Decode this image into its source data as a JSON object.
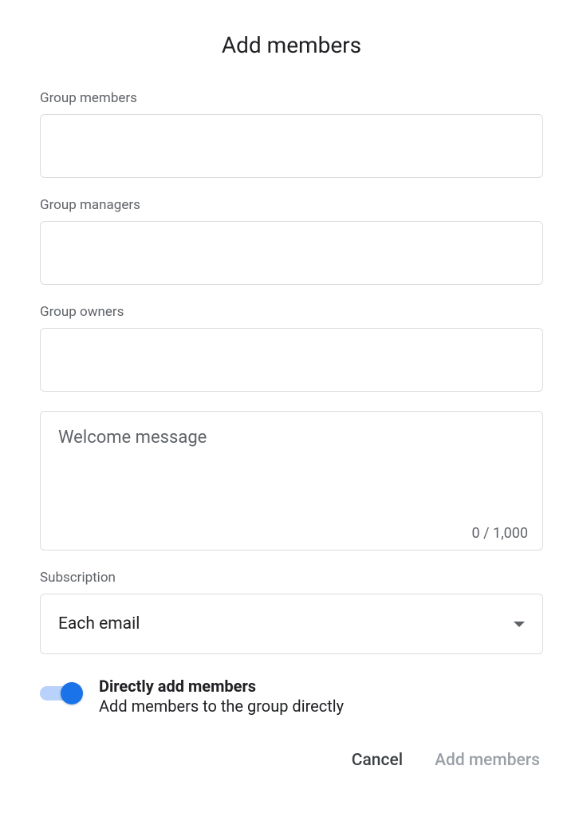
{
  "title": "Add members",
  "fields": {
    "members": {
      "label": "Group members",
      "value": ""
    },
    "managers": {
      "label": "Group managers",
      "value": ""
    },
    "owners": {
      "label": "Group owners",
      "value": ""
    }
  },
  "welcome": {
    "placeholder": "Welcome message",
    "value": "",
    "counter": "0 / 1,000"
  },
  "subscription": {
    "label": "Subscription",
    "value": "Each email"
  },
  "toggle": {
    "title": "Directly add members",
    "subtitle": "Add members to the group directly",
    "on": true
  },
  "actions": {
    "cancel": "Cancel",
    "submit": "Add members"
  }
}
